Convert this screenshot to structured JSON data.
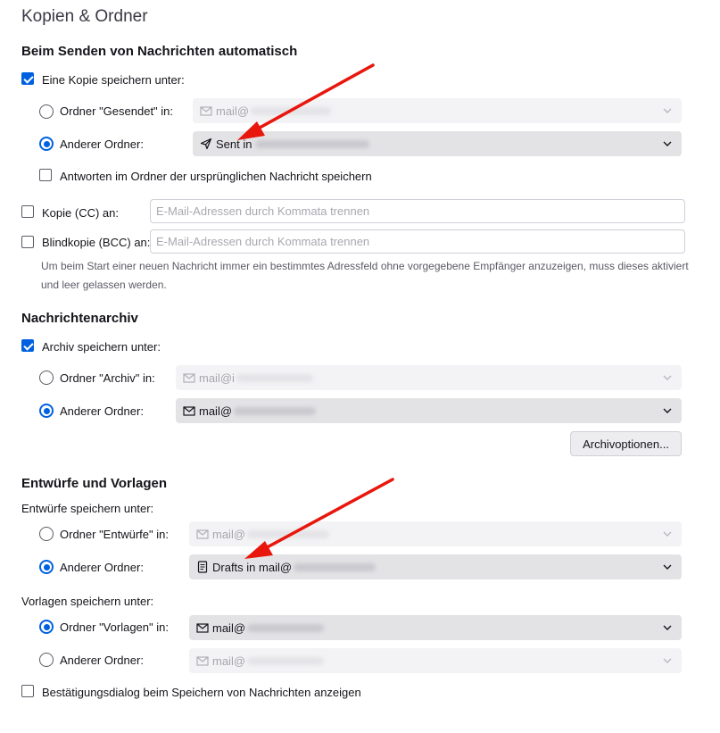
{
  "page_title": "Kopien & Ordner",
  "send_section": {
    "heading": "Beim Senden von Nachrichten automatisch",
    "save_copy_label": "Eine Kopie speichern unter:",
    "sent_folder_label": "Ordner \"Gesendet\" in:",
    "sent_folder_value": "mail@",
    "other_folder_label": "Anderer Ordner:",
    "other_folder_value": "Sent in",
    "reply_in_folder_label": "Antworten im Ordner der ursprünglichen Nachricht speichern",
    "cc_label": "Kopie (CC) an:",
    "cc_placeholder": "E-Mail-Adressen durch Kommata trennen",
    "bcc_label": "Blindkopie (BCC) an:",
    "bcc_placeholder": "E-Mail-Adressen durch Kommata trennen",
    "hint": "Um beim Start einer neuen Nachricht immer ein bestimmtes Adressfeld ohne vorgegebene Empfänger anzuzeigen, muss dieses aktiviert und leer gelassen werden."
  },
  "archive_section": {
    "heading": "Nachrichtenarchiv",
    "save_archive_label": "Archiv speichern unter:",
    "archive_folder_label": "Ordner \"Archiv\" in:",
    "archive_folder_value": "mail@i",
    "other_folder_label": "Anderer Ordner:",
    "other_folder_value": "mail@",
    "options_button": "Archivoptionen..."
  },
  "drafts_section": {
    "heading": "Entwürfe und Vorlagen",
    "drafts_label": "Entwürfe speichern unter:",
    "drafts_folder_label": "Ordner \"Entwürfe\" in:",
    "drafts_folder_value": "mail@",
    "drafts_other_label": "Anderer Ordner:",
    "drafts_other_value": "Drafts in mail@",
    "templates_label": "Vorlagen speichern unter:",
    "templates_folder_label": "Ordner \"Vorlagen\" in:",
    "templates_folder_value": "mail@",
    "templates_other_label": "Anderer Ordner:",
    "templates_other_value": "mail@",
    "confirm_label": "Bestätigungsdialog beim Speichern von Nachrichten anzeigen"
  },
  "colors": {
    "accent": "#0061e0",
    "arrow": "#e8160c"
  }
}
